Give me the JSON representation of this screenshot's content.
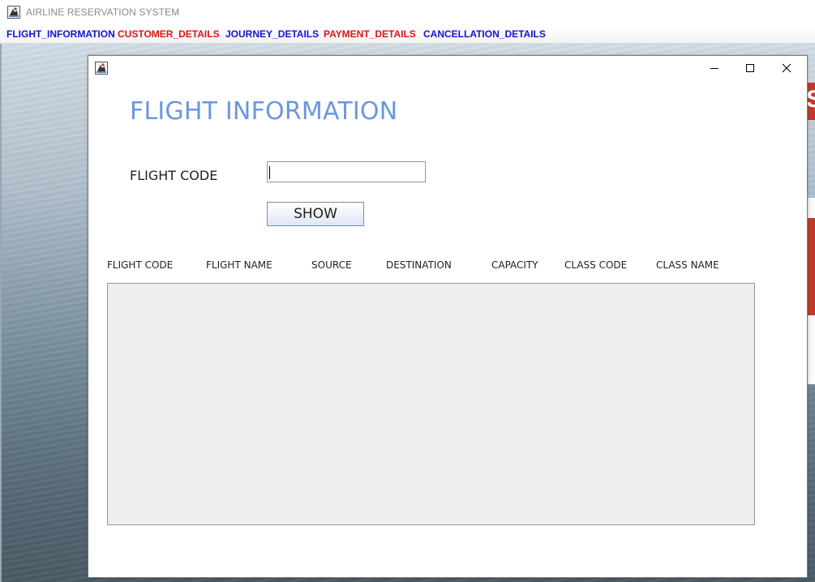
{
  "window": {
    "title": "AIRLINE RESERVATION SYSTEM",
    "icon": "java-coffee-icon"
  },
  "menu": [
    {
      "label": "FLIGHT_INFORMATION",
      "color": "#1414d2"
    },
    {
      "label": "CUSTOMER_DETAILS",
      "color": "#e01414"
    },
    {
      "label": "JOURNEY_DETAILS",
      "color": "#1414d2"
    },
    {
      "label": "PAYMENT_DETAILS",
      "color": "#e01414"
    },
    {
      "label": "CANCELLATION_DETAILS",
      "color": "#1414d2"
    }
  ],
  "background": {
    "tail_letter": "S"
  },
  "internal_frame": {
    "icon": "java-coffee-icon",
    "controls": [
      "minimize-icon",
      "maximize-icon",
      "close-icon"
    ],
    "heading": "FLIGHT INFORMATION",
    "heading_color": "#6a97df",
    "flight_code_label": "FLIGHT CODE",
    "flight_code_value": "",
    "show_button": "SHOW",
    "columns": [
      "FLIGHT CODE",
      "FLIGHT NAME",
      "SOURCE",
      "DESTINATION",
      "CAPACITY",
      "CLASS CODE",
      "CLASS NAME"
    ],
    "rows": []
  }
}
